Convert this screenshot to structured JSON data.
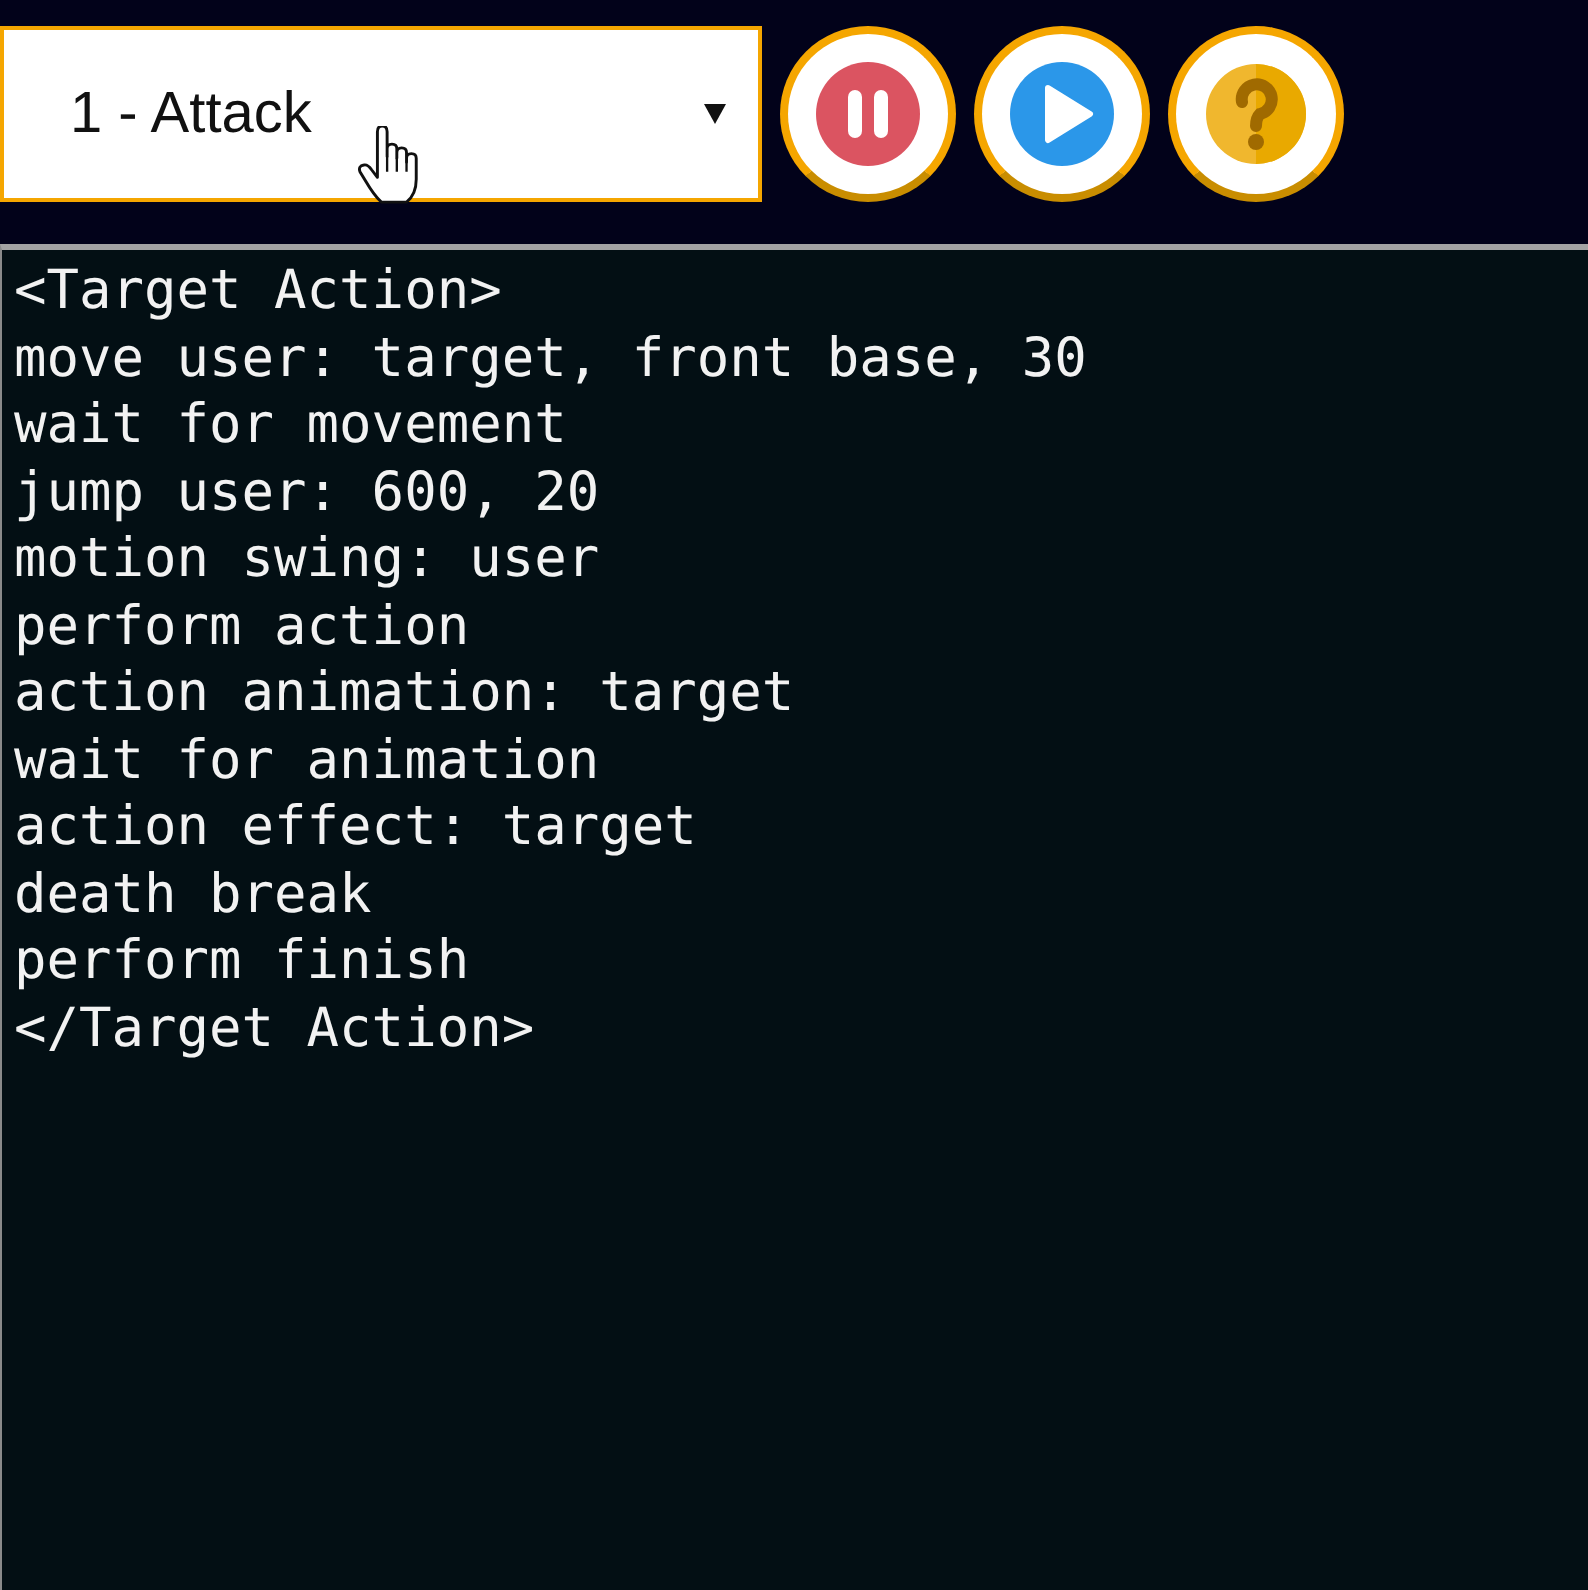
{
  "action_select": {
    "value": "1 - Attack"
  },
  "buttons": [
    {
      "kind": "pause"
    },
    {
      "kind": "play"
    },
    {
      "kind": "help"
    }
  ],
  "editor": {
    "lines": [
      "<Target Action>",
      "move user: target, front base, 30",
      "wait for movement",
      "jump user: 600, 20",
      "motion swing: user",
      "perform action",
      "action animation: target",
      "wait for animation",
      "action effect: target",
      "death break",
      "perform finish",
      "</Target Action>"
    ]
  }
}
